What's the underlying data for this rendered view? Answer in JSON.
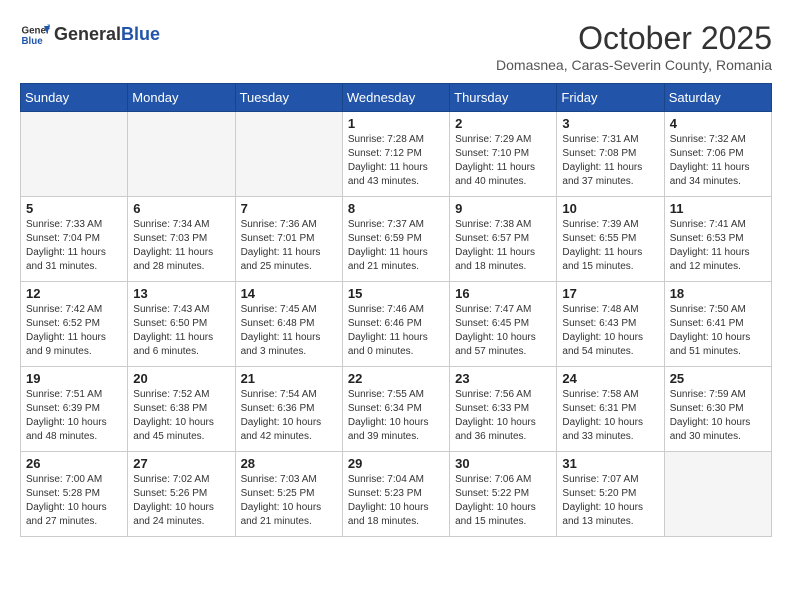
{
  "header": {
    "logo_general": "General",
    "logo_blue": "Blue",
    "month_title": "October 2025",
    "subtitle": "Domasnea, Caras-Severin County, Romania"
  },
  "days_of_week": [
    "Sunday",
    "Monday",
    "Tuesday",
    "Wednesday",
    "Thursday",
    "Friday",
    "Saturday"
  ],
  "weeks": [
    [
      {
        "day": "",
        "info": ""
      },
      {
        "day": "",
        "info": ""
      },
      {
        "day": "",
        "info": ""
      },
      {
        "day": "1",
        "info": "Sunrise: 7:28 AM\nSunset: 7:12 PM\nDaylight: 11 hours and 43 minutes."
      },
      {
        "day": "2",
        "info": "Sunrise: 7:29 AM\nSunset: 7:10 PM\nDaylight: 11 hours and 40 minutes."
      },
      {
        "day": "3",
        "info": "Sunrise: 7:31 AM\nSunset: 7:08 PM\nDaylight: 11 hours and 37 minutes."
      },
      {
        "day": "4",
        "info": "Sunrise: 7:32 AM\nSunset: 7:06 PM\nDaylight: 11 hours and 34 minutes."
      }
    ],
    [
      {
        "day": "5",
        "info": "Sunrise: 7:33 AM\nSunset: 7:04 PM\nDaylight: 11 hours and 31 minutes."
      },
      {
        "day": "6",
        "info": "Sunrise: 7:34 AM\nSunset: 7:03 PM\nDaylight: 11 hours and 28 minutes."
      },
      {
        "day": "7",
        "info": "Sunrise: 7:36 AM\nSunset: 7:01 PM\nDaylight: 11 hours and 25 minutes."
      },
      {
        "day": "8",
        "info": "Sunrise: 7:37 AM\nSunset: 6:59 PM\nDaylight: 11 hours and 21 minutes."
      },
      {
        "day": "9",
        "info": "Sunrise: 7:38 AM\nSunset: 6:57 PM\nDaylight: 11 hours and 18 minutes."
      },
      {
        "day": "10",
        "info": "Sunrise: 7:39 AM\nSunset: 6:55 PM\nDaylight: 11 hours and 15 minutes."
      },
      {
        "day": "11",
        "info": "Sunrise: 7:41 AM\nSunset: 6:53 PM\nDaylight: 11 hours and 12 minutes."
      }
    ],
    [
      {
        "day": "12",
        "info": "Sunrise: 7:42 AM\nSunset: 6:52 PM\nDaylight: 11 hours and 9 minutes."
      },
      {
        "day": "13",
        "info": "Sunrise: 7:43 AM\nSunset: 6:50 PM\nDaylight: 11 hours and 6 minutes."
      },
      {
        "day": "14",
        "info": "Sunrise: 7:45 AM\nSunset: 6:48 PM\nDaylight: 11 hours and 3 minutes."
      },
      {
        "day": "15",
        "info": "Sunrise: 7:46 AM\nSunset: 6:46 PM\nDaylight: 11 hours and 0 minutes."
      },
      {
        "day": "16",
        "info": "Sunrise: 7:47 AM\nSunset: 6:45 PM\nDaylight: 10 hours and 57 minutes."
      },
      {
        "day": "17",
        "info": "Sunrise: 7:48 AM\nSunset: 6:43 PM\nDaylight: 10 hours and 54 minutes."
      },
      {
        "day": "18",
        "info": "Sunrise: 7:50 AM\nSunset: 6:41 PM\nDaylight: 10 hours and 51 minutes."
      }
    ],
    [
      {
        "day": "19",
        "info": "Sunrise: 7:51 AM\nSunset: 6:39 PM\nDaylight: 10 hours and 48 minutes."
      },
      {
        "day": "20",
        "info": "Sunrise: 7:52 AM\nSunset: 6:38 PM\nDaylight: 10 hours and 45 minutes."
      },
      {
        "day": "21",
        "info": "Sunrise: 7:54 AM\nSunset: 6:36 PM\nDaylight: 10 hours and 42 minutes."
      },
      {
        "day": "22",
        "info": "Sunrise: 7:55 AM\nSunset: 6:34 PM\nDaylight: 10 hours and 39 minutes."
      },
      {
        "day": "23",
        "info": "Sunrise: 7:56 AM\nSunset: 6:33 PM\nDaylight: 10 hours and 36 minutes."
      },
      {
        "day": "24",
        "info": "Sunrise: 7:58 AM\nSunset: 6:31 PM\nDaylight: 10 hours and 33 minutes."
      },
      {
        "day": "25",
        "info": "Sunrise: 7:59 AM\nSunset: 6:30 PM\nDaylight: 10 hours and 30 minutes."
      }
    ],
    [
      {
        "day": "26",
        "info": "Sunrise: 7:00 AM\nSunset: 5:28 PM\nDaylight: 10 hours and 27 minutes."
      },
      {
        "day": "27",
        "info": "Sunrise: 7:02 AM\nSunset: 5:26 PM\nDaylight: 10 hours and 24 minutes."
      },
      {
        "day": "28",
        "info": "Sunrise: 7:03 AM\nSunset: 5:25 PM\nDaylight: 10 hours and 21 minutes."
      },
      {
        "day": "29",
        "info": "Sunrise: 7:04 AM\nSunset: 5:23 PM\nDaylight: 10 hours and 18 minutes."
      },
      {
        "day": "30",
        "info": "Sunrise: 7:06 AM\nSunset: 5:22 PM\nDaylight: 10 hours and 15 minutes."
      },
      {
        "day": "31",
        "info": "Sunrise: 7:07 AM\nSunset: 5:20 PM\nDaylight: 10 hours and 13 minutes."
      },
      {
        "day": "",
        "info": ""
      }
    ]
  ]
}
